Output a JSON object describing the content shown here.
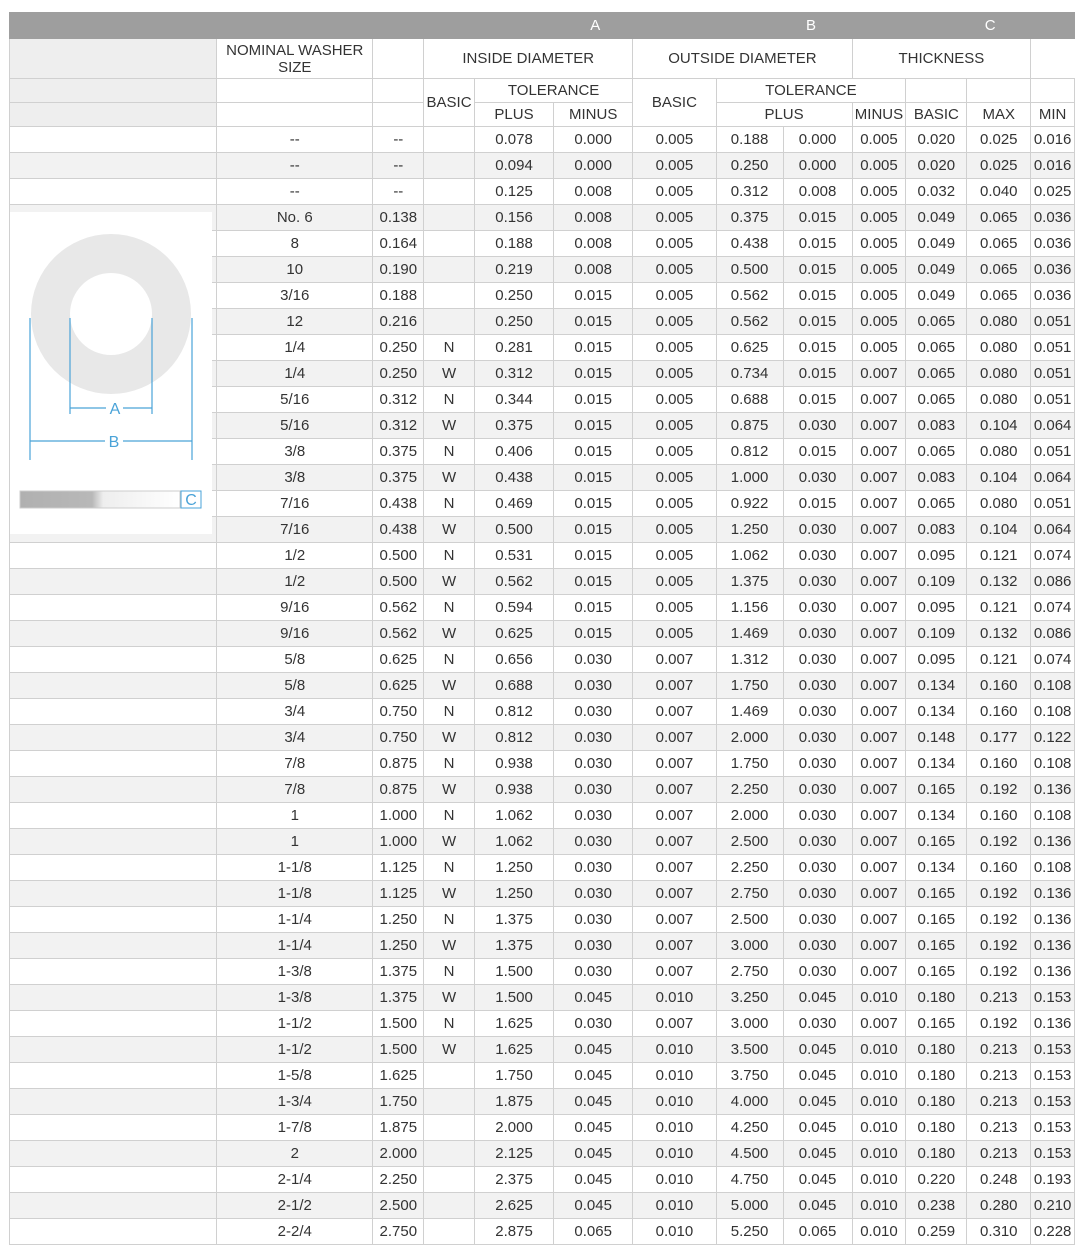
{
  "header": {
    "letters": {
      "a": "A",
      "b": "B",
      "c": "C"
    },
    "nominal_washer_size": "NOMINAL WASHER SIZE",
    "inside_diameter": "INSIDE DIAMETER",
    "outside_diameter": "OUTSIDE DIAMETER",
    "thickness": "THICKNESS",
    "basic": "BASIC",
    "tolerance": "TOLERANCE",
    "plus": "PLUS",
    "minus": "MINUS",
    "max": "MAX",
    "min": "MIN"
  },
  "diagram": {
    "label_a": "A",
    "label_b": "B",
    "label_c": "C",
    "ring_color": "#e8e8e8",
    "line_color": "#4aa3d8"
  },
  "columns": [
    "size",
    "size_decimal",
    "series",
    "id_basic",
    "id_tol_plus",
    "id_tol_minus",
    "od_basic",
    "od_tol_plus",
    "od_tol_minus",
    "th_basic",
    "th_max",
    "th_min"
  ],
  "rows": [
    [
      "--",
      "--",
      "",
      "0.078",
      "0.000",
      "0.005",
      "0.188",
      "0.000",
      "0.005",
      "0.020",
      "0.025",
      "0.016"
    ],
    [
      "--",
      "--",
      "",
      "0.094",
      "0.000",
      "0.005",
      "0.250",
      "0.000",
      "0.005",
      "0.020",
      "0.025",
      "0.016"
    ],
    [
      "--",
      "--",
      "",
      "0.125",
      "0.008",
      "0.005",
      "0.312",
      "0.008",
      "0.005",
      "0.032",
      "0.040",
      "0.025"
    ],
    [
      "No. 6",
      "0.138",
      "",
      "0.156",
      "0.008",
      "0.005",
      "0.375",
      "0.015",
      "0.005",
      "0.049",
      "0.065",
      "0.036"
    ],
    [
      "8",
      "0.164",
      "",
      "0.188",
      "0.008",
      "0.005",
      "0.438",
      "0.015",
      "0.005",
      "0.049",
      "0.065",
      "0.036"
    ],
    [
      "10",
      "0.190",
      "",
      "0.219",
      "0.008",
      "0.005",
      "0.500",
      "0.015",
      "0.005",
      "0.049",
      "0.065",
      "0.036"
    ],
    [
      "3/16",
      "0.188",
      "",
      "0.250",
      "0.015",
      "0.005",
      "0.562",
      "0.015",
      "0.005",
      "0.049",
      "0.065",
      "0.036"
    ],
    [
      "12",
      "0.216",
      "",
      "0.250",
      "0.015",
      "0.005",
      "0.562",
      "0.015",
      "0.005",
      "0.065",
      "0.080",
      "0.051"
    ],
    [
      "1/4",
      "0.250",
      "N",
      "0.281",
      "0.015",
      "0.005",
      "0.625",
      "0.015",
      "0.005",
      "0.065",
      "0.080",
      "0.051"
    ],
    [
      "1/4",
      "0.250",
      "W",
      "0.312",
      "0.015",
      "0.005",
      "0.734",
      "0.015",
      "0.007",
      "0.065",
      "0.080",
      "0.051"
    ],
    [
      "5/16",
      "0.312",
      "N",
      "0.344",
      "0.015",
      "0.005",
      "0.688",
      "0.015",
      "0.007",
      "0.065",
      "0.080",
      "0.051"
    ],
    [
      "5/16",
      "0.312",
      "W",
      "0.375",
      "0.015",
      "0.005",
      "0.875",
      "0.030",
      "0.007",
      "0.083",
      "0.104",
      "0.064"
    ],
    [
      "3/8",
      "0.375",
      "N",
      "0.406",
      "0.015",
      "0.005",
      "0.812",
      "0.015",
      "0.007",
      "0.065",
      "0.080",
      "0.051"
    ],
    [
      "3/8",
      "0.375",
      "W",
      "0.438",
      "0.015",
      "0.005",
      "1.000",
      "0.030",
      "0.007",
      "0.083",
      "0.104",
      "0.064"
    ],
    [
      "7/16",
      "0.438",
      "N",
      "0.469",
      "0.015",
      "0.005",
      "0.922",
      "0.015",
      "0.007",
      "0.065",
      "0.080",
      "0.051"
    ],
    [
      "7/16",
      "0.438",
      "W",
      "0.500",
      "0.015",
      "0.005",
      "1.250",
      "0.030",
      "0.007",
      "0.083",
      "0.104",
      "0.064"
    ],
    [
      "1/2",
      "0.500",
      "N",
      "0.531",
      "0.015",
      "0.005",
      "1.062",
      "0.030",
      "0.007",
      "0.095",
      "0.121",
      "0.074"
    ],
    [
      "1/2",
      "0.500",
      "W",
      "0.562",
      "0.015",
      "0.005",
      "1.375",
      "0.030",
      "0.007",
      "0.109",
      "0.132",
      "0.086"
    ],
    [
      "9/16",
      "0.562",
      "N",
      "0.594",
      "0.015",
      "0.005",
      "1.156",
      "0.030",
      "0.007",
      "0.095",
      "0.121",
      "0.074"
    ],
    [
      "9/16",
      "0.562",
      "W",
      "0.625",
      "0.015",
      "0.005",
      "1.469",
      "0.030",
      "0.007",
      "0.109",
      "0.132",
      "0.086"
    ],
    [
      "5/8",
      "0.625",
      "N",
      "0.656",
      "0.030",
      "0.007",
      "1.312",
      "0.030",
      "0.007",
      "0.095",
      "0.121",
      "0.074"
    ],
    [
      "5/8",
      "0.625",
      "W",
      "0.688",
      "0.030",
      "0.007",
      "1.750",
      "0.030",
      "0.007",
      "0.134",
      "0.160",
      "0.108"
    ],
    [
      "3/4",
      "0.750",
      "N",
      "0.812",
      "0.030",
      "0.007",
      "1.469",
      "0.030",
      "0.007",
      "0.134",
      "0.160",
      "0.108"
    ],
    [
      "3/4",
      "0.750",
      "W",
      "0.812",
      "0.030",
      "0.007",
      "2.000",
      "0.030",
      "0.007",
      "0.148",
      "0.177",
      "0.122"
    ],
    [
      "7/8",
      "0.875",
      "N",
      "0.938",
      "0.030",
      "0.007",
      "1.750",
      "0.030",
      "0.007",
      "0.134",
      "0.160",
      "0.108"
    ],
    [
      "7/8",
      "0.875",
      "W",
      "0.938",
      "0.030",
      "0.007",
      "2.250",
      "0.030",
      "0.007",
      "0.165",
      "0.192",
      "0.136"
    ],
    [
      "1",
      "1.000",
      "N",
      "1.062",
      "0.030",
      "0.007",
      "2.000",
      "0.030",
      "0.007",
      "0.134",
      "0.160",
      "0.108"
    ],
    [
      "1",
      "1.000",
      "W",
      "1.062",
      "0.030",
      "0.007",
      "2.500",
      "0.030",
      "0.007",
      "0.165",
      "0.192",
      "0.136"
    ],
    [
      "1-1/8",
      "1.125",
      "N",
      "1.250",
      "0.030",
      "0.007",
      "2.250",
      "0.030",
      "0.007",
      "0.134",
      "0.160",
      "0.108"
    ],
    [
      "1-1/8",
      "1.125",
      "W",
      "1.250",
      "0.030",
      "0.007",
      "2.750",
      "0.030",
      "0.007",
      "0.165",
      "0.192",
      "0.136"
    ],
    [
      "1-1/4",
      "1.250",
      "N",
      "1.375",
      "0.030",
      "0.007",
      "2.500",
      "0.030",
      "0.007",
      "0.165",
      "0.192",
      "0.136"
    ],
    [
      "1-1/4",
      "1.250",
      "W",
      "1.375",
      "0.030",
      "0.007",
      "3.000",
      "0.030",
      "0.007",
      "0.165",
      "0.192",
      "0.136"
    ],
    [
      "1-3/8",
      "1.375",
      "N",
      "1.500",
      "0.030",
      "0.007",
      "2.750",
      "0.030",
      "0.007",
      "0.165",
      "0.192",
      "0.136"
    ],
    [
      "1-3/8",
      "1.375",
      "W",
      "1.500",
      "0.045",
      "0.010",
      "3.250",
      "0.045",
      "0.010",
      "0.180",
      "0.213",
      "0.153"
    ],
    [
      "1-1/2",
      "1.500",
      "N",
      "1.625",
      "0.030",
      "0.007",
      "3.000",
      "0.030",
      "0.007",
      "0.165",
      "0.192",
      "0.136"
    ],
    [
      "1-1/2",
      "1.500",
      "W",
      "1.625",
      "0.045",
      "0.010",
      "3.500",
      "0.045",
      "0.010",
      "0.180",
      "0.213",
      "0.153"
    ],
    [
      "1-5/8",
      "1.625",
      "",
      "1.750",
      "0.045",
      "0.010",
      "3.750",
      "0.045",
      "0.010",
      "0.180",
      "0.213",
      "0.153"
    ],
    [
      "1-3/4",
      "1.750",
      "",
      "1.875",
      "0.045",
      "0.010",
      "4.000",
      "0.045",
      "0.010",
      "0.180",
      "0.213",
      "0.153"
    ],
    [
      "1-7/8",
      "1.875",
      "",
      "2.000",
      "0.045",
      "0.010",
      "4.250",
      "0.045",
      "0.010",
      "0.180",
      "0.213",
      "0.153"
    ],
    [
      "2",
      "2.000",
      "",
      "2.125",
      "0.045",
      "0.010",
      "4.500",
      "0.045",
      "0.010",
      "0.180",
      "0.213",
      "0.153"
    ],
    [
      "2-1/4",
      "2.250",
      "",
      "2.375",
      "0.045",
      "0.010",
      "4.750",
      "0.045",
      "0.010",
      "0.220",
      "0.248",
      "0.193"
    ],
    [
      "2-1/2",
      "2.500",
      "",
      "2.625",
      "0.045",
      "0.010",
      "5.000",
      "0.045",
      "0.010",
      "0.238",
      "0.280",
      "0.210"
    ],
    [
      "2-2/4",
      "2.750",
      "",
      "2.875",
      "0.065",
      "0.010",
      "5.250",
      "0.065",
      "0.010",
      "0.259",
      "0.310",
      "0.228"
    ]
  ]
}
